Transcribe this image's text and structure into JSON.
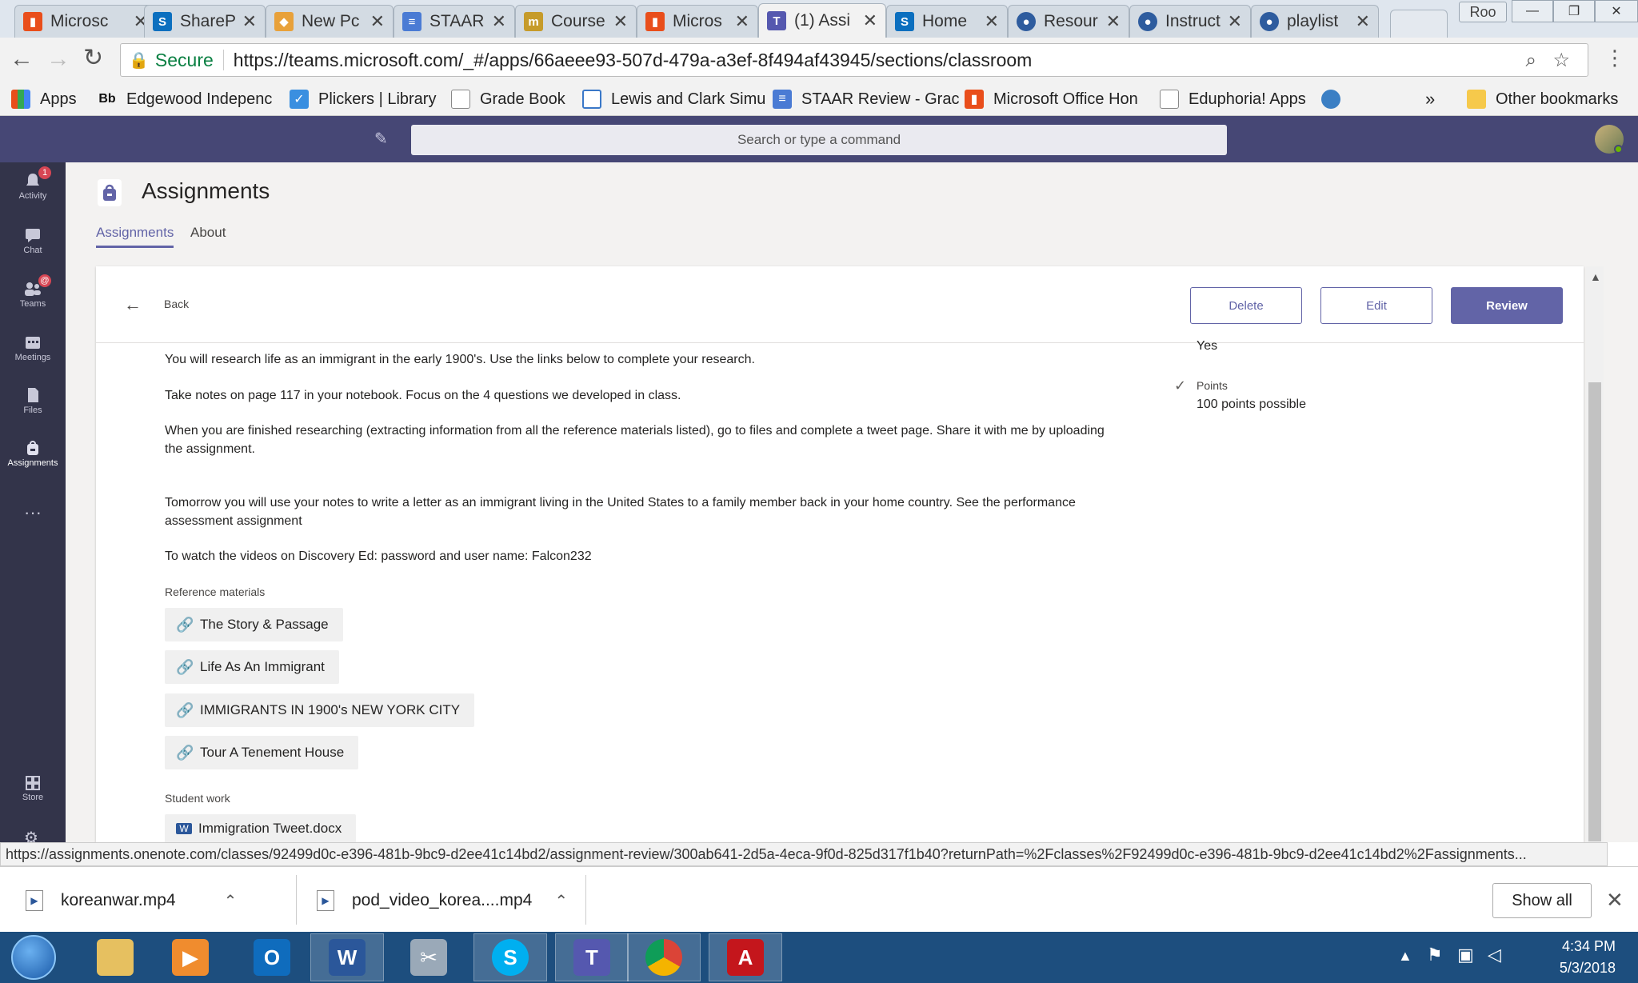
{
  "browser": {
    "tabs": [
      {
        "title": "Microsc",
        "color": "#e94e1b",
        "glyph": "▮"
      },
      {
        "title": "ShareP",
        "color": "#0b6fbf",
        "glyph": "S"
      },
      {
        "title": "New Pc",
        "color": "#e8a13a",
        "glyph": "◆"
      },
      {
        "title": "STAAR",
        "color": "#4a7bd4",
        "glyph": "≡"
      },
      {
        "title": "Course",
        "color": "#c69b2a",
        "glyph": "m"
      },
      {
        "title": "Micros",
        "color": "#e94e1b",
        "glyph": "▮"
      },
      {
        "title": "(1) Assi",
        "color": "#5558af",
        "glyph": "T"
      },
      {
        "title": "Home",
        "color": "#0b6fbf",
        "glyph": "S"
      },
      {
        "title": "Resour",
        "color": "#2e5c9e",
        "glyph": "●"
      },
      {
        "title": "Instruct",
        "color": "#2e5c9e",
        "glyph": "●"
      },
      {
        "title": "playlist",
        "color": "#2e5c9e",
        "glyph": "●"
      }
    ],
    "profile_label": "Roo",
    "secure_label": "Secure",
    "url": "https://teams.microsoft.com/_#/apps/66aeee93-507d-479a-a3ef-8f494af43945/sections/classroom",
    "bookmarks": [
      {
        "label": "Apps"
      },
      {
        "label": "Edgewood Indepenc"
      },
      {
        "label": "Plickers | Library"
      },
      {
        "label": "Grade Book"
      },
      {
        "label": "Lewis and Clark Simu"
      },
      {
        "label": "STAAR Review - Grac"
      },
      {
        "label": "Microsoft Office Hon"
      },
      {
        "label": "Eduphoria! Apps"
      }
    ],
    "overflow_label": "»",
    "other_bookmarks_label": "Other bookmarks"
  },
  "teams": {
    "search_placeholder": "Search or type a command",
    "rail": [
      {
        "label": "Activity",
        "badge": "1"
      },
      {
        "label": "Chat",
        "badge": ""
      },
      {
        "label": "Teams",
        "badge": "@"
      },
      {
        "label": "Meetings",
        "badge": ""
      },
      {
        "label": "Files",
        "badge": ""
      },
      {
        "label": "Assignments",
        "badge": ""
      }
    ],
    "rail_more": "···",
    "rail_store": "Store",
    "app_title": "Assignments",
    "tabs": [
      {
        "label": "Assignments",
        "active": true
      },
      {
        "label": "About",
        "active": false
      }
    ],
    "back_label": "Back",
    "actions": {
      "delete": "Delete",
      "edit": "Edit",
      "review": "Review"
    },
    "side": {
      "yes_value": "Yes",
      "points_label": "Points",
      "points_value": "100 points possible"
    },
    "instructions": [
      "You will research life as an immigrant in the early 1900's.  Use the links below to complete your research.",
      "Take notes on page 117 in your notebook.  Focus on the 4 questions we developed in class.",
      "When  you are finished researching (extracting information from all the reference materials listed), go to files and complete a tweet page.  Share it with me by uploading the assignment.",
      "Tomorrow you will use your notes to write a letter as an immigrant living in the United States to a family member back in your home country.  See the performance assessment assignment",
      "To watch the videos on Discovery Ed:   password and user name:  Falcon232"
    ],
    "reference_heading": "Reference materials",
    "references": [
      {
        "label": "The Story & Passage"
      },
      {
        "label": "Life As An Immigrant"
      },
      {
        "label": "IMMIGRANTS IN 1900's NEW YORK CITY"
      },
      {
        "label": "Tour A Tenement House"
      }
    ],
    "student_work_heading": "Student work",
    "student_work": [
      {
        "label": "Immigration Tweet.docx"
      }
    ]
  },
  "status_url": "https://assignments.onenote.com/classes/92499d0c-e396-481b-9bc9-d2ee41c14bd2/assignment-review/300ab641-2d5a-4eca-9f0d-825d317f1b40?returnPath=%2Fclasses%2F92499d0c-e396-481b-9bc9-d2ee41c14bd2%2Fassignments...",
  "downloads": {
    "items": [
      {
        "name": "koreanwar.mp4"
      },
      {
        "name": "pod_video_korea....mp4"
      }
    ],
    "show_all": "Show all"
  },
  "taskbar": {
    "time": "4:34 PM",
    "date": "5/3/2018"
  }
}
